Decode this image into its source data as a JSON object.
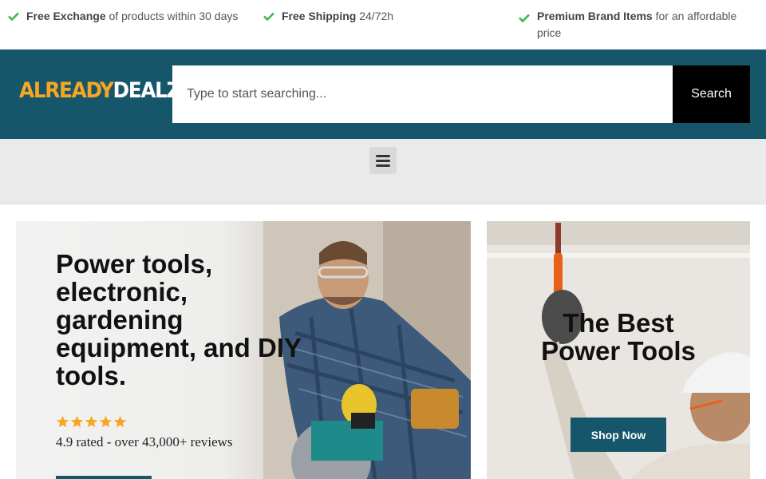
{
  "benefits": [
    {
      "bold": "Free Exchange",
      "text": " of products within 30 days"
    },
    {
      "bold": "Free Shipping",
      "text": " 24/72h"
    },
    {
      "bold": "Premium Brand Items",
      "text": " for an affordable price"
    }
  ],
  "header": {
    "logo_part1": "ALREADY",
    "logo_part2": "DEALZ",
    "search_placeholder": "Type to start searching...",
    "search_button": "Search"
  },
  "colors": {
    "brand_teal": "#16566a",
    "logo_orange": "#f5a623",
    "check_green": "#3db84a",
    "star_orange": "#f5a623"
  },
  "hero_left": {
    "title": "Power tools, electronic, gardening equipment, and DIY tools.",
    "stars": 5,
    "rating_text": "4.9 rated - over 43,000+ reviews"
  },
  "hero_right": {
    "title": "The Best Power Tools",
    "button": "Shop Now"
  },
  "icons": {
    "check": "check-icon",
    "menu": "hamburger-menu-icon",
    "star": "star-icon"
  }
}
